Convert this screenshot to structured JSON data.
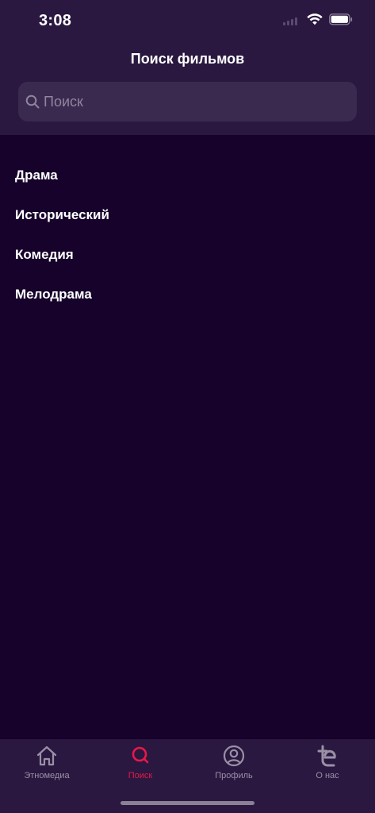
{
  "status_bar": {
    "time": "3:08"
  },
  "header": {
    "title": "Поиск фильмов"
  },
  "search": {
    "placeholder": "Поиск",
    "value": ""
  },
  "genres": [
    {
      "label": "Драма"
    },
    {
      "label": "Исторический"
    },
    {
      "label": "Комедия"
    },
    {
      "label": "Мелодрама"
    }
  ],
  "tab_bar": {
    "tabs": [
      {
        "label": "Этномедиа",
        "icon": "home-icon",
        "active": false
      },
      {
        "label": "Поиск",
        "icon": "search-icon",
        "active": true
      },
      {
        "label": "Профиль",
        "icon": "profile-icon",
        "active": false
      },
      {
        "label": "О нас",
        "icon": "brand-logo-icon",
        "active": false
      }
    ]
  },
  "colors": {
    "background": "#16022b",
    "header_background": "#2a1840",
    "search_field": "#3a2a50",
    "accent": "#e8184a",
    "inactive_tab": "#9a90a6"
  }
}
